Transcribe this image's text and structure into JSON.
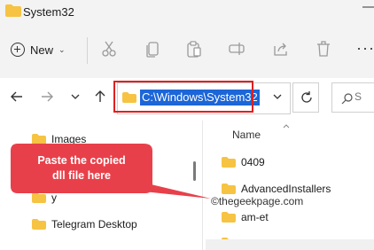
{
  "window": {
    "title": "System32"
  },
  "toolbar": {
    "new_label": "New",
    "more": "···"
  },
  "address": {
    "path": "C:\\Windows\\System32"
  },
  "search": {
    "placeholder": "S"
  },
  "nav": {
    "items": [
      "Images",
      "y",
      "Telegram Desktop"
    ]
  },
  "files": {
    "column_name": "Name",
    "rows": [
      "0409",
      "AdvancedInstallers",
      "am-et"
    ]
  },
  "callout": {
    "line1": "Paste the copied",
    "line2": "dll file here"
  },
  "watermark": {
    "text": "©thegeekpage.com"
  },
  "colors": {
    "folder": "#f6c343",
    "highlight": "#1c66d8",
    "callout": "#e8404a",
    "box": "#e02020"
  }
}
